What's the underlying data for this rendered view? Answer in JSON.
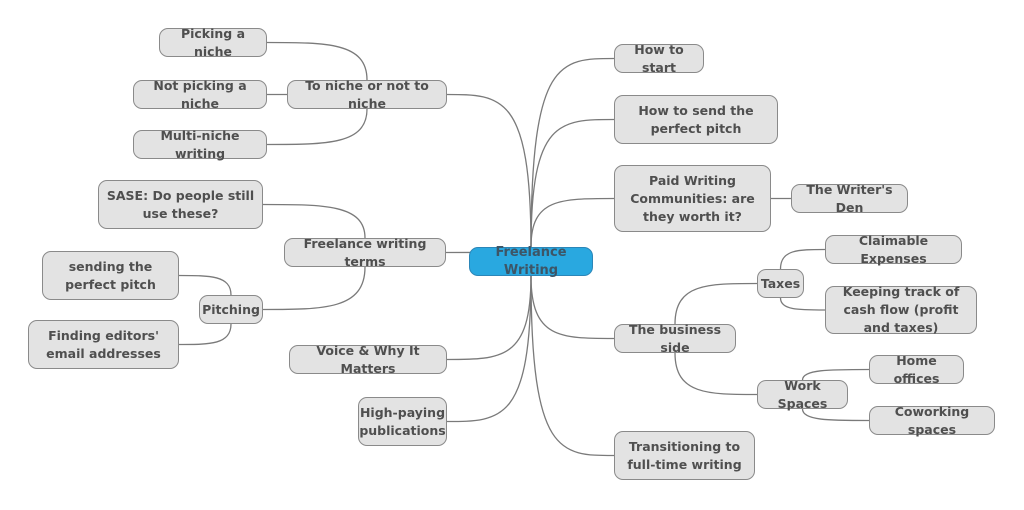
{
  "title": "Freelance Writing",
  "colors": {
    "root_fill": "#29a8e0",
    "node_fill": "#e3e3e3",
    "node_border": "#8a8a8a",
    "text": "#4f4f4f",
    "connector": "#7a7a7a"
  },
  "nodes": {
    "root": "Freelance Writing",
    "niche": "To niche or not to niche",
    "picking_niche": "Picking a niche",
    "not_picking_niche": "Not picking a niche",
    "multi_niche": "Multi-niche writing",
    "terms": "Freelance writing terms",
    "sase": "SASE: Do people still use these?",
    "pitching": "Pitching",
    "sending_pitch": "sending the perfect pitch",
    "finding_emails": "Finding editors' email addresses",
    "voice": "Voice & Why It Matters",
    "high_paying": "High-paying publications",
    "how_to_start": "How to start",
    "send_pitch": "How to send the perfect pitch",
    "paid_communities": "Paid Writing Communities: are they worth it?",
    "writers_den": "The Writer's Den",
    "business": "The business side",
    "taxes": "Taxes",
    "claimable": "Claimable Expenses",
    "cash_flow": "Keeping track of cash flow (profit and taxes)",
    "work_spaces": "Work Spaces",
    "home_offices": "Home offices",
    "coworking": "Coworking spaces",
    "transitioning": "Transitioning to full-time writing"
  },
  "edges": [
    [
      "root",
      "niche"
    ],
    [
      "root",
      "terms"
    ],
    [
      "root",
      "voice"
    ],
    [
      "root",
      "high_paying"
    ],
    [
      "root",
      "how_to_start"
    ],
    [
      "root",
      "send_pitch"
    ],
    [
      "root",
      "paid_communities"
    ],
    [
      "root",
      "business"
    ],
    [
      "root",
      "transitioning"
    ],
    [
      "niche",
      "picking_niche"
    ],
    [
      "niche",
      "not_picking_niche"
    ],
    [
      "niche",
      "multi_niche"
    ],
    [
      "terms",
      "sase"
    ],
    [
      "terms",
      "pitching"
    ],
    [
      "pitching",
      "sending_pitch"
    ],
    [
      "pitching",
      "finding_emails"
    ],
    [
      "paid_communities",
      "writers_den"
    ],
    [
      "business",
      "taxes"
    ],
    [
      "business",
      "work_spaces"
    ],
    [
      "taxes",
      "claimable"
    ],
    [
      "taxes",
      "cash_flow"
    ],
    [
      "work_spaces",
      "home_offices"
    ],
    [
      "work_spaces",
      "coworking"
    ]
  ]
}
